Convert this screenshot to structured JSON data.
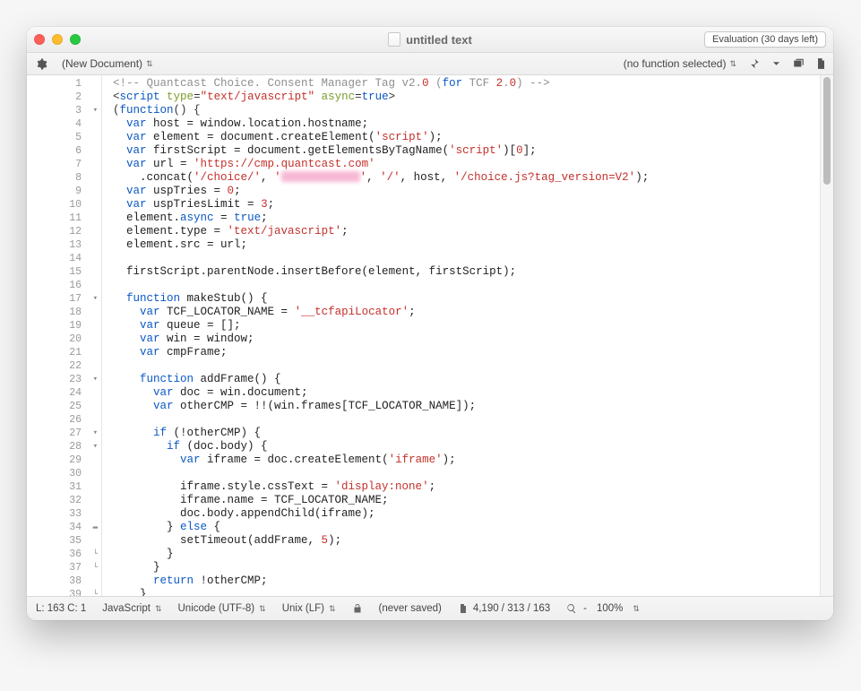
{
  "window": {
    "title": "untitled text",
    "eval_badge": "Evaluation (30 days left)"
  },
  "toolbar": {
    "doc_menu": "(New Document)",
    "func_menu": "(no function selected)"
  },
  "gutter": {
    "lines": [
      {
        "n": "1",
        "f": ""
      },
      {
        "n": "2",
        "f": ""
      },
      {
        "n": "3",
        "f": "▾"
      },
      {
        "n": "4",
        "f": ""
      },
      {
        "n": "5",
        "f": ""
      },
      {
        "n": "6",
        "f": ""
      },
      {
        "n": "7",
        "f": ""
      },
      {
        "n": "8",
        "f": ""
      },
      {
        "n": "9",
        "f": ""
      },
      {
        "n": "10",
        "f": ""
      },
      {
        "n": "11",
        "f": ""
      },
      {
        "n": "12",
        "f": ""
      },
      {
        "n": "13",
        "f": ""
      },
      {
        "n": "14",
        "f": ""
      },
      {
        "n": "15",
        "f": ""
      },
      {
        "n": "16",
        "f": ""
      },
      {
        "n": "17",
        "f": "▾"
      },
      {
        "n": "18",
        "f": ""
      },
      {
        "n": "19",
        "f": ""
      },
      {
        "n": "20",
        "f": ""
      },
      {
        "n": "21",
        "f": ""
      },
      {
        "n": "22",
        "f": ""
      },
      {
        "n": "23",
        "f": "▾"
      },
      {
        "n": "24",
        "f": ""
      },
      {
        "n": "25",
        "f": ""
      },
      {
        "n": "26",
        "f": ""
      },
      {
        "n": "27",
        "f": "▾"
      },
      {
        "n": "28",
        "f": "▾"
      },
      {
        "n": "29",
        "f": ""
      },
      {
        "n": "30",
        "f": ""
      },
      {
        "n": "31",
        "f": ""
      },
      {
        "n": "32",
        "f": ""
      },
      {
        "n": "33",
        "f": ""
      },
      {
        "n": "34",
        "f": "▬"
      },
      {
        "n": "35",
        "f": ""
      },
      {
        "n": "36",
        "f": "└"
      },
      {
        "n": "37",
        "f": "└"
      },
      {
        "n": "38",
        "f": ""
      },
      {
        "n": "39",
        "f": "└"
      }
    ]
  },
  "code": {
    "l1": {
      "a": "<!-- Quantcast Choice. Consent Manager Tag v2.",
      "b": "0",
      "c": " (",
      "d": "for",
      "e": " TCF ",
      "f": "2",
      "g": ".",
      "h": "0",
      "i": ") -->"
    },
    "l2": {
      "a": "<",
      "b": "script",
      "c": " ",
      "d": "type",
      "e": "=",
      "f": "\"text/javascript\"",
      "g": " ",
      "h": "async",
      "i": "=",
      "j": "true",
      "k": ">"
    },
    "l3": {
      "a": "(",
      "b": "function",
      "c": "() {"
    },
    "l4": {
      "a": "var",
      "b": " host = window.location.hostname;"
    },
    "l5": {
      "a": "var",
      "b": " element = document.createElement(",
      "c": "'script'",
      "d": ");"
    },
    "l6": {
      "a": "var",
      "b": " firstScript = document.getElementsByTagName(",
      "c": "'script'",
      "d": ")[",
      "e": "0",
      "f": "];"
    },
    "l7": {
      "a": "var",
      "b": " url = ",
      "c": "'https://cmp.quantcast.com'"
    },
    "l8": {
      "a": ".concat(",
      "b": "'/choice/'",
      "c": ", ",
      "d": "'",
      "e": "'",
      "f": ", ",
      "g": "'/'",
      "h": ", host, ",
      "i": "'/choice.js?tag_version=V2'",
      "j": ");"
    },
    "l9": {
      "a": "var",
      "b": " uspTries = ",
      "c": "0",
      "d": ";"
    },
    "l10": {
      "a": "var",
      "b": " uspTriesLimit = ",
      "c": "3",
      "d": ";"
    },
    "l11": {
      "a": "element.",
      "b": "async",
      "c": " = ",
      "d": "true",
      "e": ";"
    },
    "l12": {
      "a": "element.type = ",
      "b": "'text/javascript'",
      "c": ";"
    },
    "l13": {
      "a": "element.src = url;"
    },
    "l15": {
      "a": "firstScript.parentNode.insertBefore(element, firstScript);"
    },
    "l17": {
      "a": "function",
      "b": " makeStub() {"
    },
    "l18": {
      "a": "var",
      "b": " TCF_LOCATOR_NAME = ",
      "c": "'__tcfapiLocator'",
      "d": ";"
    },
    "l19": {
      "a": "var",
      "b": " queue = [];"
    },
    "l20": {
      "a": "var",
      "b": " win = window;"
    },
    "l21": {
      "a": "var",
      "b": " cmpFrame;"
    },
    "l23": {
      "a": "function",
      "b": " addFrame() {"
    },
    "l24": {
      "a": "var",
      "b": " doc = win.document;"
    },
    "l25": {
      "a": "var",
      "b": " otherCMP = !!(win.frames[TCF_LOCATOR_NAME]);"
    },
    "l27": {
      "a": "if",
      "b": " (!otherCMP) {"
    },
    "l28": {
      "a": "if",
      "b": " (doc.body) {"
    },
    "l29": {
      "a": "var",
      "b": " iframe = doc.createElement(",
      "c": "'iframe'",
      "d": ");"
    },
    "l31": {
      "a": "iframe.style.cssText = ",
      "b": "'display:none'",
      "c": ";"
    },
    "l32": {
      "a": "iframe.name = TCF_LOCATOR_NAME;"
    },
    "l33": {
      "a": "doc.body.appendChild(iframe);"
    },
    "l34": {
      "a": "} ",
      "b": "else",
      "c": " {"
    },
    "l35": {
      "a": "setTimeout(addFrame, ",
      "b": "5",
      "c": ");"
    },
    "l36": {
      "a": "}"
    },
    "l37": {
      "a": "}"
    },
    "l38": {
      "a": "return",
      "b": " !otherCMP;"
    },
    "l39": {
      "a": "}"
    }
  },
  "status": {
    "pos": "L: 163 C: 1",
    "lang": "JavaScript",
    "encoding": "Unicode (UTF-8)",
    "line_ending": "Unix (LF)",
    "saved": "(never saved)",
    "counts": "4,190 / 313 / 163",
    "zoom": "100%"
  }
}
